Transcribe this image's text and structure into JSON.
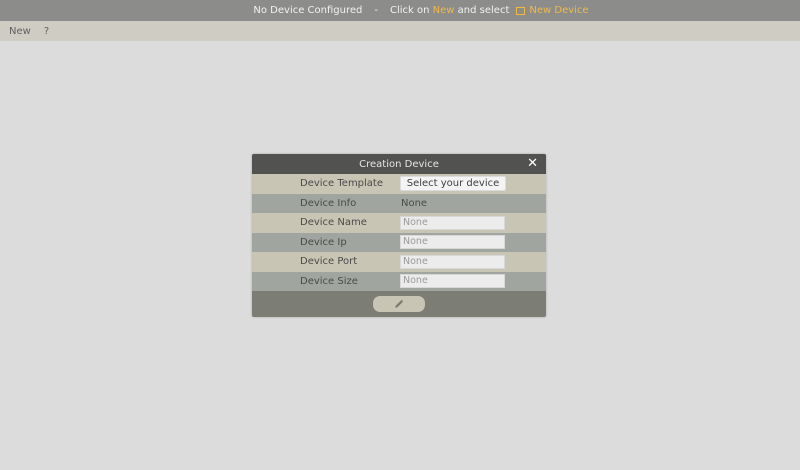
{
  "topbar": {
    "status": "No Device Configured",
    "separator": "-",
    "click_on": "Click on",
    "new_link": "New",
    "and_select": "and select",
    "new_device": "New Device",
    "accent_color": "#f0b94a"
  },
  "menu": {
    "new": "New",
    "help": "?"
  },
  "dialog": {
    "title": "Creation Device",
    "close_icon": "close-icon",
    "rows": [
      {
        "label": "Device Template",
        "button": "Select your device"
      },
      {
        "label": "Device Info",
        "value": "None"
      },
      {
        "label": "Device Name",
        "placeholder": "None"
      },
      {
        "label": "Device Ip",
        "placeholder": "None"
      },
      {
        "label": "Device Port",
        "placeholder": "None"
      },
      {
        "label": "Device Size",
        "placeholder": "None"
      }
    ],
    "footer_icon": "pencil-icon"
  }
}
